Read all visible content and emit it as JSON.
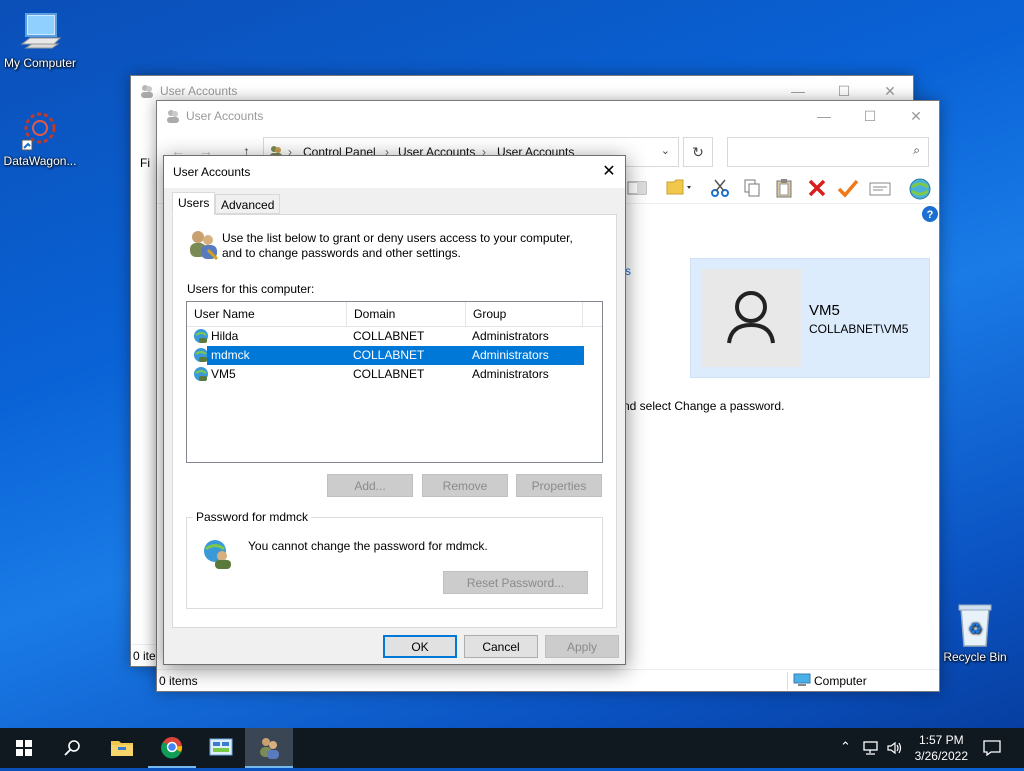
{
  "desktop": {
    "icons": [
      {
        "label": "My Computer",
        "icon": "monitor-icon"
      },
      {
        "label": "DataWagon...",
        "icon": "datawagon-icon"
      },
      {
        "label": "Recycle Bin",
        "icon": "recycle-bin-icon"
      }
    ]
  },
  "back_window": {
    "title": "User Accounts",
    "menu_partial": "Fi",
    "status": "0 ite"
  },
  "main_window": {
    "title": "User Accounts",
    "breadcrumb": [
      "Control Panel",
      "User Accounts",
      "User Accounts"
    ],
    "search_placeholder": "",
    "user_card": {
      "name": "VM5",
      "account": "COLLABNET\\VM5"
    },
    "partial_link": "s",
    "partial_text": "nd select Change a password.",
    "status_left": "0 items",
    "status_right": "Computer"
  },
  "dialog": {
    "title": "User Accounts",
    "tabs": [
      {
        "label": "Users",
        "active": true
      },
      {
        "label": "Advanced",
        "active": false
      }
    ],
    "intro": "Use the list below to grant or deny users access to your computer, and to change passwords and other settings.",
    "users_label": "Users for this computer:",
    "columns": [
      "User Name",
      "Domain",
      "Group"
    ],
    "rows": [
      {
        "name": "Hilda",
        "domain": "COLLABNET",
        "group": "Administrators",
        "selected": false
      },
      {
        "name": "mdmck",
        "domain": "COLLABNET",
        "group": "Administrators",
        "selected": true
      },
      {
        "name": "VM5",
        "domain": "COLLABNET",
        "group": "Administrators",
        "selected": false
      }
    ],
    "buttons": {
      "add": "Add...",
      "remove": "Remove",
      "properties": "Properties"
    },
    "password_group": {
      "legend": "Password for mdmck",
      "message": "You cannot change the password for mdmck.",
      "reset": "Reset Password..."
    },
    "footer": {
      "ok": "OK",
      "cancel": "Cancel",
      "apply": "Apply"
    }
  },
  "taskbar": {
    "time": "1:57 PM",
    "date": "3/26/2022"
  },
  "colors": {
    "accent": "#0078d7",
    "selection": "#0078d7",
    "taskbar": "#101820"
  }
}
